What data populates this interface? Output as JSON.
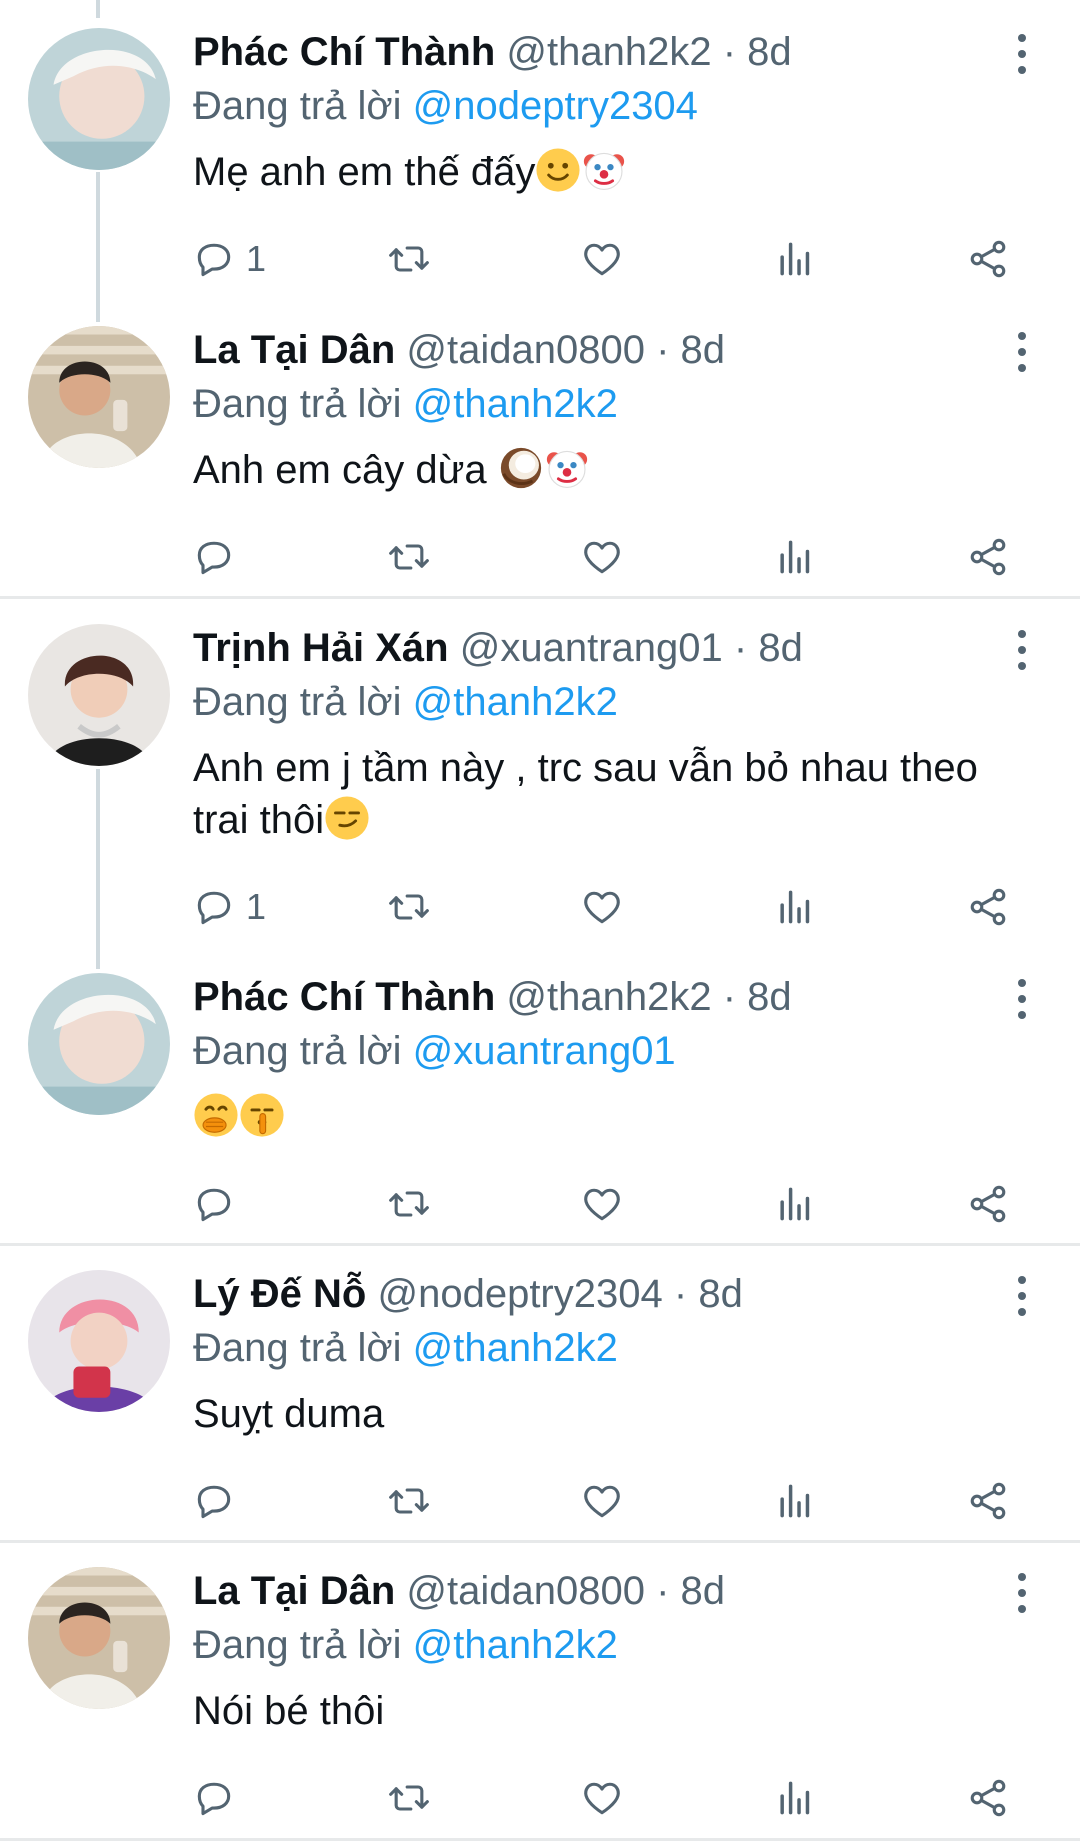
{
  "tweets": [
    {
      "name": "Phác Chí Thành",
      "handle": "@thanh2k2",
      "sep": "·",
      "time": "8d",
      "replying_label": "Đang trả lời",
      "reply_to": "@nodeptry2304",
      "text": "Mẹ anh em thế đấy",
      "reply_count": "1"
    },
    {
      "name": "La Tại Dân",
      "handle": "@taidan0800",
      "sep": "·",
      "time": "8d",
      "replying_label": "Đang trả lời",
      "reply_to": "@thanh2k2",
      "text": "Anh em cây dừa ",
      "reply_count": ""
    },
    {
      "name": "Trịnh Hải Xán",
      "handle": "@xuantrang01",
      "sep": "·",
      "time": "8d",
      "replying_label": "Đang trả lời",
      "reply_to": "@thanh2k2",
      "text": "Anh em j tầm này , trc sau vẫn bỏ nhau theo trai thôi",
      "reply_count": "1"
    },
    {
      "name": "Phác Chí Thành",
      "handle": "@thanh2k2",
      "sep": "·",
      "time": "8d",
      "replying_label": "Đang trả lời",
      "reply_to": "@xuantrang01",
      "text": "",
      "reply_count": ""
    },
    {
      "name": "Lý Đế Nỗ",
      "handle": "@nodeptry2304",
      "sep": "·",
      "time": "8d",
      "replying_label": "Đang trả lời",
      "reply_to": "@thanh2k2",
      "text": "Suỵt duma",
      "reply_count": ""
    },
    {
      "name": "La Tại Dân",
      "handle": "@taidan0800",
      "sep": "·",
      "time": "8d",
      "replying_label": "Đang trả lời",
      "reply_to": "@thanh2k2",
      "text": "Nói bé thôi",
      "reply_count": ""
    }
  ],
  "icons": [
    "reply-icon",
    "retweet-icon",
    "like-icon",
    "views-icon",
    "share-icon",
    "more-icon"
  ],
  "emoji": [
    "slightly-smiling-face",
    "clown-face",
    "coconut",
    "smirking-face",
    "face-with-hand-over-mouth",
    "shushing-face"
  ],
  "colors": {
    "link": "#1d9bf0",
    "secondary_text": "#536471",
    "primary_text": "#0f1419",
    "divider": "#e7e9ea",
    "thread_line": "#cfd9de"
  }
}
